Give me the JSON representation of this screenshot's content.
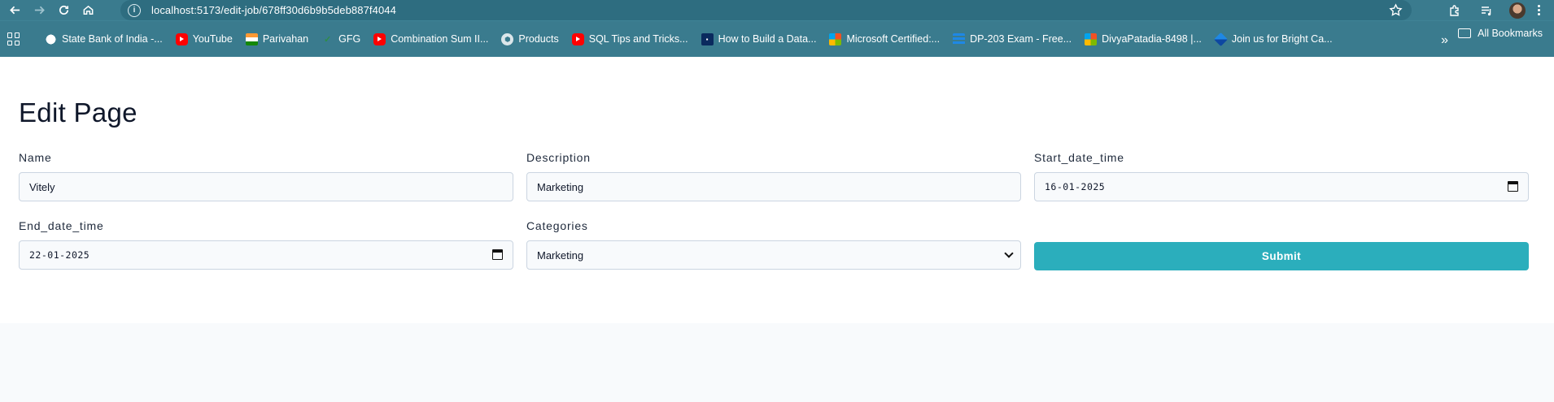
{
  "browser": {
    "url": "localhost:5173/edit-job/678ff30d6b9b5deb887f4044"
  },
  "bookmarks": {
    "items": [
      {
        "label": "State Bank of India -...",
        "icon": "globe-icon"
      },
      {
        "label": "YouTube",
        "icon": "youtube-icon"
      },
      {
        "label": "Parivahan",
        "icon": "india-flag-icon"
      },
      {
        "label": "GFG",
        "icon": "gfg-icon"
      },
      {
        "label": "Combination Sum II...",
        "icon": "youtube-icon"
      },
      {
        "label": "Products",
        "icon": "products-icon"
      },
      {
        "label": "SQL Tips and Tricks...",
        "icon": "youtube-icon"
      },
      {
        "label": "How to Build a Data...",
        "icon": "site-icon"
      },
      {
        "label": "Microsoft Certified:...",
        "icon": "microsoft-icon"
      },
      {
        "label": "DP-203 Exam - Free...",
        "icon": "bars-icon"
      },
      {
        "label": "DivyaPatadia-8498 |...",
        "icon": "microsoft-icon"
      },
      {
        "label": "Join us for Bright Ca...",
        "icon": "kite-icon"
      }
    ],
    "all_bookmarks": "All Bookmarks"
  },
  "page": {
    "title": "Edit Page",
    "fields": {
      "name": {
        "label": "Name",
        "value": "Vitely"
      },
      "description": {
        "label": "Description",
        "value": "Marketing"
      },
      "start": {
        "label": "Start_date_time",
        "value": "16-01-2025"
      },
      "end": {
        "label": "End_date_time",
        "value": "22-01-2025"
      },
      "categories": {
        "label": "Categories",
        "value": "Marketing"
      }
    },
    "submit_label": "Submit"
  },
  "colors": {
    "chrome": "#3a7b8e",
    "submit": "#2baebc"
  }
}
